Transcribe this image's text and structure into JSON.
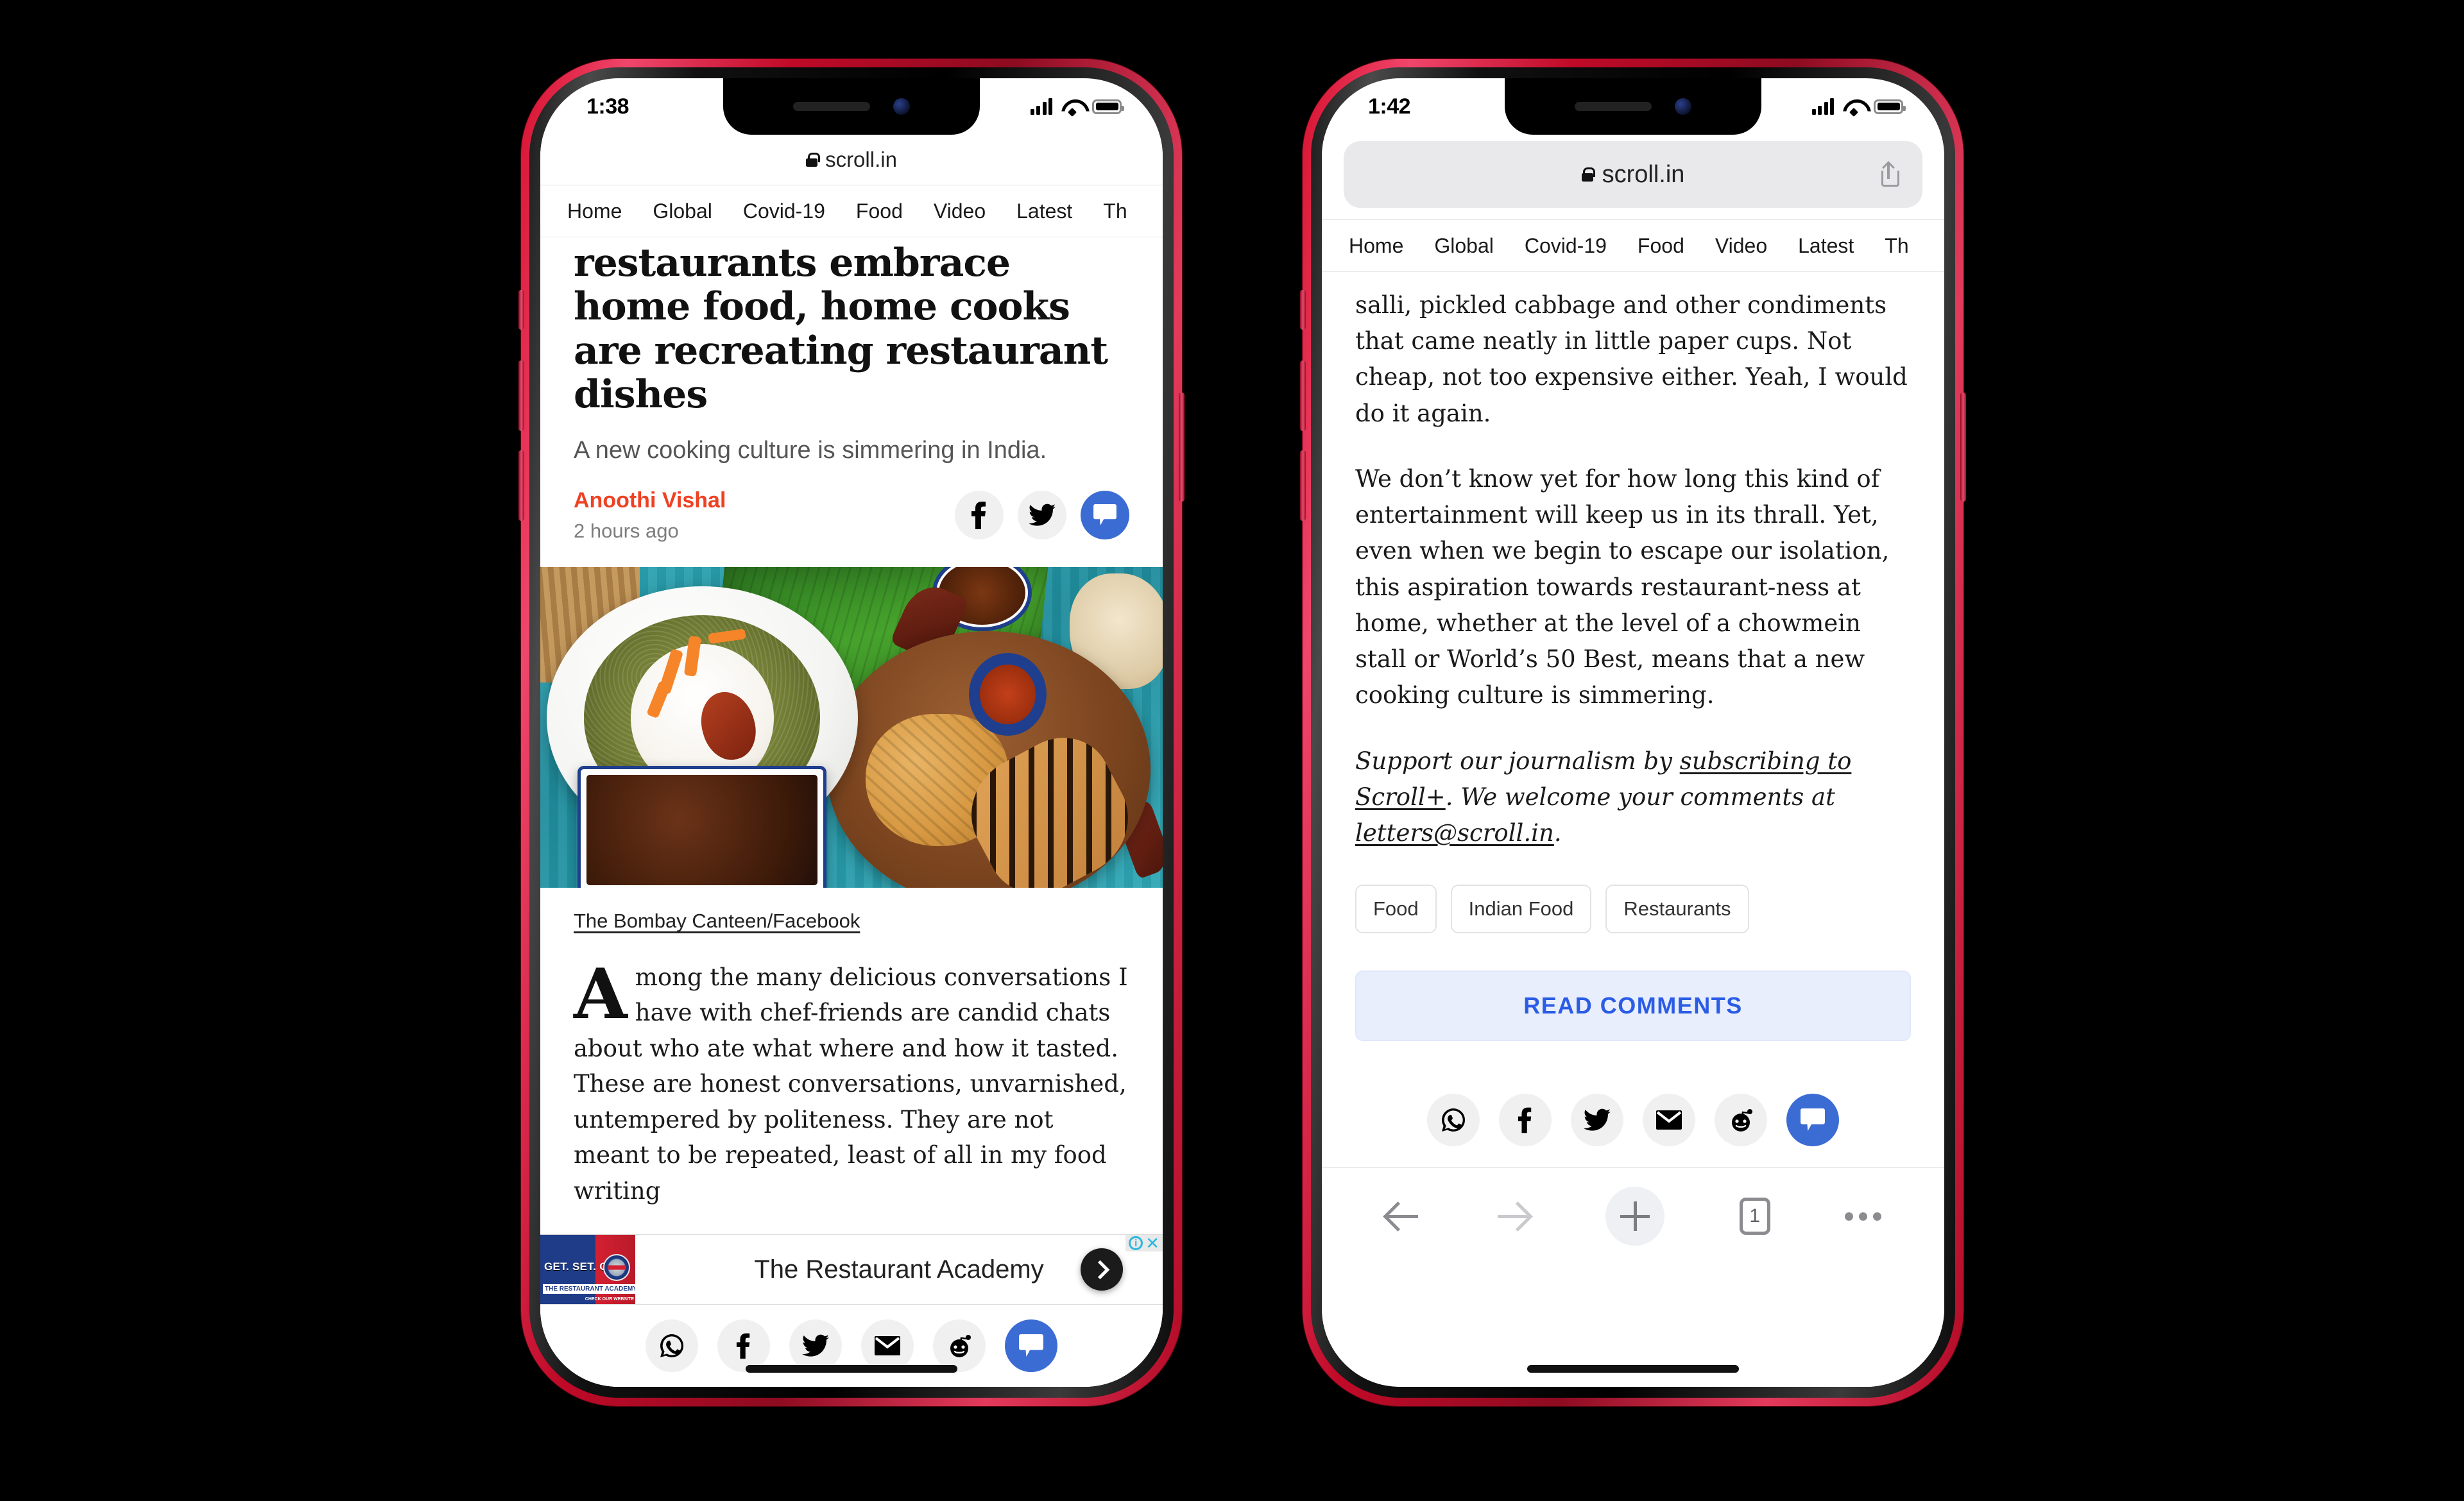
{
  "phone_left": {
    "status": {
      "time": "1:38",
      "signal_icon": "cellular-bars-icon",
      "wifi_icon": "wifi-icon",
      "battery_icon": "battery-icon"
    },
    "browser": {
      "url": "scroll.in",
      "lock_icon": "lock-icon"
    },
    "site_nav": [
      "Home",
      "Global",
      "Covid-19",
      "Food",
      "Video",
      "Latest",
      "Th"
    ],
    "article": {
      "headline": "restaurants embrace home food, home cooks are recreating restaurant dishes",
      "standfirst": "A new cooking culture is simmering in India.",
      "author": "Anoothi Vishal",
      "timeago": "2 hours ago",
      "caption": "The Bombay Canteen/Facebook",
      "dropcap": "A",
      "paragraph": "mong the many delicious conversations I have with chef-friends are candid chats about who ate what where and how it tasted. These are honest conversations, unvarnished, untempered by politeness. They are not meant to be repeated, least of all in my food writing"
    },
    "header_share": [
      {
        "name": "facebook-share-icon",
        "glyph": "f"
      },
      {
        "name": "twitter-share-icon",
        "glyph": "t"
      },
      {
        "name": "comments-icon",
        "glyph": "c"
      }
    ],
    "ad": {
      "title": "The Restaurant Academy",
      "thumb_line1": "GET. SET. GO",
      "thumb_line2": "THE RESTAURANT ACADEMY",
      "thumb_line3": "CHECK OUR WEBSITE",
      "info_label": "i",
      "close_label": "✕",
      "next_icon": "chevron-right-icon"
    },
    "share_bar": [
      "whatsapp-share-icon",
      "facebook-share-icon",
      "twitter-share-icon",
      "email-share-icon",
      "reddit-share-icon",
      "comments-icon"
    ]
  },
  "phone_right": {
    "status": {
      "time": "1:42",
      "signal_icon": "cellular-bars-icon",
      "wifi_icon": "wifi-icon",
      "battery_icon": "battery-icon"
    },
    "browser": {
      "url": "scroll.in",
      "lock_icon": "lock-icon",
      "share_icon": "ios-share-icon"
    },
    "site_nav": [
      "Home",
      "Global",
      "Covid-19",
      "Food",
      "Video",
      "Latest",
      "Th"
    ],
    "article": {
      "paragraph_1": "salli, pickled cabbage and other condiments that came neatly in little paper cups. Not cheap, not too expensive either. Yeah, I would do it again.",
      "paragraph_2": "We don’t know yet for how long this kind of entertainment will keep us in its thrall. Yet, even when we begin to escape our isolation, this aspiration towards restaurant-ness at home, whether at the level of a chowmein stall or World’s 50 Best, means that a new cooking culture is simmering.",
      "support_prefix": "Support our journalism by ",
      "support_link": "subscribing to Scroll+",
      "support_middle": ". We welcome your comments at ",
      "support_email": "letters@scroll.in",
      "support_suffix": "."
    },
    "tags": [
      "Food",
      "Indian Food",
      "Restaurants"
    ],
    "read_comments_label": "READ COMMENTS",
    "share_bar": [
      "whatsapp-share-icon",
      "facebook-share-icon",
      "twitter-share-icon",
      "email-share-icon",
      "reddit-share-icon",
      "comments-icon"
    ],
    "safari_toolbar": {
      "back_icon": "back-arrow-icon",
      "forward_icon": "forward-arrow-icon",
      "new_tab_icon": "plus-icon",
      "tab_count": "1",
      "more_icon": "more-dots-icon"
    }
  },
  "colors": {
    "accent_blue": "#3b6cd4",
    "author_orange": "#ef4123",
    "read_comments_blue": "#2b5ce6",
    "read_comments_bg": "#e8eefb",
    "frame_red": "#d7112f",
    "background": "#000000"
  }
}
